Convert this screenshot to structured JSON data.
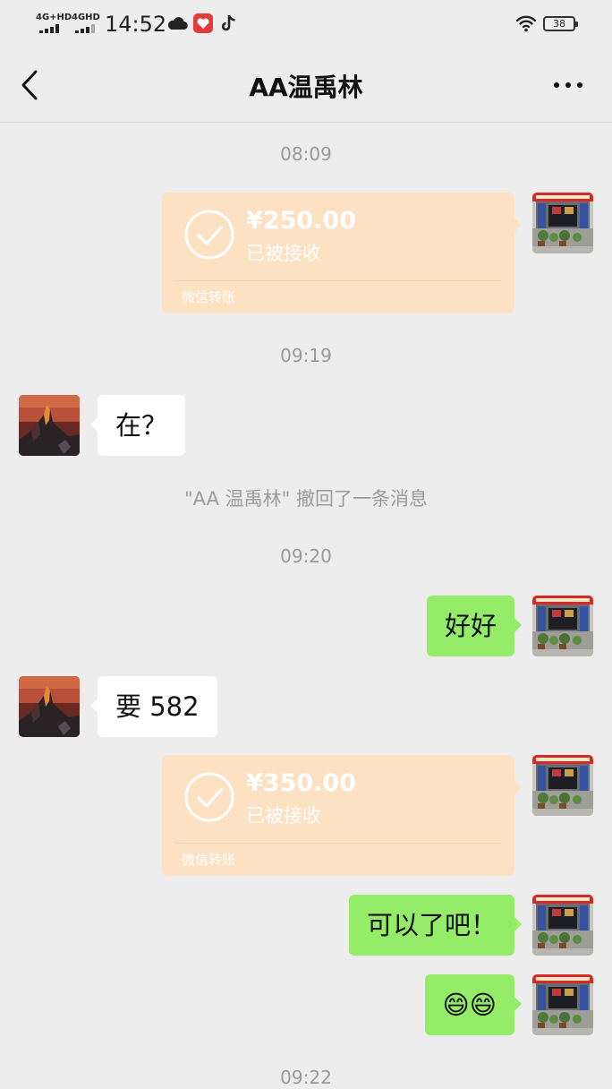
{
  "status_bar": {
    "signal1_label": "4G+HD",
    "signal2_label": "4GHD",
    "time": "14:52",
    "battery": "38"
  },
  "nav": {
    "title": "AA温禹林",
    "back_icon": "chevron-left-icon",
    "more_icon": "ellipsis-icon"
  },
  "messages": [
    {
      "type": "timestamp",
      "text": "08:09"
    },
    {
      "type": "transfer",
      "from": "me",
      "amount": "¥250.00",
      "status": "已被接收",
      "footer": "微信转账"
    },
    {
      "type": "timestamp",
      "text": "09:19"
    },
    {
      "type": "text",
      "from": "them",
      "text": "在？"
    },
    {
      "type": "recall",
      "text": "\"AA 温禹林\" 撤回了一条消息"
    },
    {
      "type": "timestamp",
      "text": "09:20"
    },
    {
      "type": "text",
      "from": "me",
      "text": "好好"
    },
    {
      "type": "text",
      "from": "them",
      "text": "要 582"
    },
    {
      "type": "transfer",
      "from": "me",
      "amount": "¥350.00",
      "status": "已被接收",
      "footer": "微信转账"
    },
    {
      "type": "text",
      "from": "me",
      "text": "可以了吧！"
    },
    {
      "type": "text",
      "from": "me",
      "text": "😄😄"
    },
    {
      "type": "timestamp",
      "text": "09:22"
    }
  ],
  "colors": {
    "background": "#ededed",
    "bubble_out": "#95ec69",
    "bubble_in": "#ffffff",
    "transfer_accepted": "#fde1c3"
  }
}
